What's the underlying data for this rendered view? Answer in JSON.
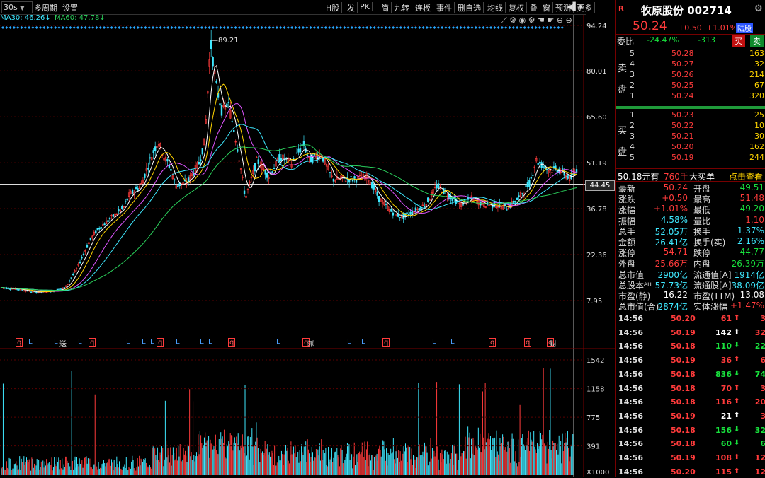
{
  "toolbar": {
    "period": "30s",
    "multi_period": "多周期",
    "settings": "设置",
    "right_items": [
      "H股",
      "发",
      "PK",
      "简",
      "九转",
      "连板",
      "事件",
      "删自选",
      "均线",
      "复权",
      "叠",
      "窗",
      "预测",
      "更多"
    ],
    "icons": [
      "back-arrow-icon",
      "dropdown-icon"
    ]
  },
  "ma_line": {
    "ma30_text": "MA30: 46.26↓",
    "ma60_text": "MA60: 47.78↓",
    "ma30_color": "#3ee8ff",
    "ma60_color": "#2bd15c"
  },
  "chart_tools": [
    "crosshair-icon",
    "gear-icon",
    "eye-icon",
    "gear2-icon",
    "hand-icon",
    "hand2-icon",
    "zoom-in-icon",
    "zoom-out-icon"
  ],
  "price_axis": {
    "labels": [
      "94.24",
      "80.01",
      "65.60",
      "51.19",
      "36.78",
      "22.36",
      "7.95"
    ],
    "current": "44.45"
  },
  "peak_label": "89.21",
  "event_markers": [
    "q",
    "L",
    "L",
    "L",
    "q",
    "L",
    "L",
    "L",
    "q",
    "L",
    "L",
    "L",
    "q",
    "L",
    "q",
    "L",
    "L",
    "q",
    "L",
    "L",
    "q",
    "q",
    "q"
  ],
  "event_extra": [
    "送",
    "派",
    "财"
  ],
  "volume_axis": {
    "labels": [
      "1542",
      "1158",
      "775",
      "391"
    ],
    "unit": "X1000"
  },
  "chart_data": {
    "type": "line",
    "title": "",
    "y_range": [
      0,
      94.24
    ],
    "reference_price": 44.45,
    "peak": 89.21,
    "price_path": [
      [
        0,
        12.0
      ],
      [
        3,
        11.5
      ],
      [
        6,
        10.5
      ],
      [
        9,
        11.0
      ],
      [
        11,
        12.0
      ],
      [
        13,
        18
      ],
      [
        15,
        26
      ],
      [
        16,
        29
      ],
      [
        17,
        31
      ],
      [
        19,
        34
      ],
      [
        21,
        37
      ],
      [
        22,
        41
      ],
      [
        24,
        44
      ],
      [
        26,
        54
      ],
      [
        27,
        58
      ],
      [
        28,
        53
      ],
      [
        29,
        50
      ],
      [
        30,
        44
      ],
      [
        32,
        45
      ],
      [
        34,
        51
      ],
      [
        35,
        58
      ],
      [
        36,
        89.2
      ],
      [
        37,
        75
      ],
      [
        38,
        67
      ],
      [
        39,
        70
      ],
      [
        40,
        62
      ],
      [
        41,
        52
      ],
      [
        42,
        40
      ],
      [
        43,
        46
      ],
      [
        44,
        52
      ],
      [
        46,
        47
      ],
      [
        48,
        53
      ],
      [
        50,
        51
      ],
      [
        52,
        57
      ],
      [
        53,
        52
      ],
      [
        55,
        54
      ],
      [
        57,
        46
      ],
      [
        59,
        46
      ],
      [
        61,
        46
      ],
      [
        63,
        47
      ],
      [
        65,
        40
      ],
      [
        67,
        36
      ],
      [
        69,
        34
      ],
      [
        71,
        36
      ],
      [
        73,
        38
      ],
      [
        75,
        44
      ],
      [
        77,
        41
      ],
      [
        79,
        38
      ],
      [
        81,
        40
      ],
      [
        83,
        38
      ],
      [
        85,
        38
      ],
      [
        87,
        37
      ],
      [
        89,
        40
      ],
      [
        91,
        45
      ],
      [
        92,
        52
      ],
      [
        94,
        49
      ],
      [
        96,
        49
      ],
      [
        98,
        46
      ],
      [
        99,
        49
      ]
    ],
    "volume_scale_max": 1542
  },
  "right_panel": {
    "logo": "R",
    "stock_name": "牧原股份",
    "code": "002714",
    "price": "50.24",
    "change": "+0.50",
    "change_pct": "+1.01%",
    "badge": "陆股",
    "weibi_label": "委比",
    "weibi_value": "-24.47%",
    "weicha_value": "-313",
    "buy_btn": "买",
    "sell_btn": "卖",
    "sell_side_label": [
      "卖",
      "盘"
    ],
    "buy_side_label": [
      "买",
      "盘"
    ],
    "asks": [
      {
        "level": "5",
        "price": "50.28",
        "vol": "163"
      },
      {
        "level": "4",
        "price": "50.27",
        "vol": "32"
      },
      {
        "level": "3",
        "price": "50.26",
        "vol": "214"
      },
      {
        "level": "2",
        "price": "50.25",
        "vol": "67"
      },
      {
        "level": "1",
        "price": "50.24",
        "vol": "320"
      }
    ],
    "bids": [
      {
        "level": "1",
        "price": "50.23",
        "vol": "25"
      },
      {
        "level": "2",
        "price": "50.22",
        "vol": "10"
      },
      {
        "level": "3",
        "price": "50.21",
        "vol": "30"
      },
      {
        "level": "4",
        "price": "50.20",
        "vol": "162"
      },
      {
        "level": "5",
        "price": "50.19",
        "vol": "244"
      }
    ],
    "big_order": {
      "price": "50.18元有",
      "qty": "760手",
      "type": "大买单",
      "link": "点击查看"
    },
    "stats": [
      {
        "l1": "最新",
        "v1": "50.24",
        "c1": "red",
        "l2": "开盘",
        "v2": "49.51",
        "c2": "green"
      },
      {
        "l1": "涨跌",
        "v1": "+0.50",
        "c1": "red",
        "l2": "最高",
        "v2": "51.48",
        "c2": "red"
      },
      {
        "l1": "涨幅",
        "v1": "+1.01%",
        "c1": "red",
        "l2": "最低",
        "v2": "49.20",
        "c2": "green"
      },
      {
        "l1": "振幅",
        "v1": "4.58%",
        "c1": "cyan",
        "l2": "量比",
        "v2": "1.10",
        "c2": "red"
      },
      {
        "l1": "总手",
        "v1": "52.05万",
        "c1": "cyan",
        "l2": "换手",
        "v2": "1.37%",
        "c2": "cyan"
      },
      {
        "l1": "金额",
        "v1": "26.41亿",
        "c1": "cyan",
        "l2": "换手(实)",
        "v2": "2.16%",
        "c2": "cyan"
      },
      {
        "l1": "涨停",
        "v1": "54.71",
        "c1": "red",
        "l2": "跌停",
        "v2": "44.77",
        "c2": "green"
      },
      {
        "l1": "外盘",
        "v1": "25.66万",
        "c1": "red",
        "l2": "内盘",
        "v2": "26.39万",
        "c2": "green"
      },
      {
        "l1": "总市值",
        "v1": "2900亿",
        "c1": "cyan",
        "l2": "流通值[A]",
        "v2": "1914亿",
        "c2": "cyan"
      },
      {
        "l1": "总股本ᴬᴴ",
        "v1": "57.73亿",
        "c1": "cyan",
        "l2": "流通股[A]",
        "v2": "38.09亿",
        "c2": "cyan"
      },
      {
        "l1": "市盈(静)",
        "v1": "16.22",
        "c1": "white",
        "l2": "市盈(TTM)",
        "v2": "13.08",
        "c2": "white"
      },
      {
        "l1": "总市值(合)",
        "v1": "2874亿",
        "c1": "cyan",
        "l2": "实体涨幅",
        "v2": "+1.47%",
        "c2": "red"
      }
    ],
    "ticks": [
      {
        "time": "14:56",
        "price": "50.20",
        "pc": "red",
        "vol": "61",
        "vc": "red",
        "dir": "up",
        "n": "3"
      },
      {
        "time": "14:56",
        "price": "50.19",
        "pc": "red",
        "vol": "142",
        "vc": "white",
        "dir": "up",
        "n": "32"
      },
      {
        "time": "14:56",
        "price": "50.18",
        "pc": "red",
        "vol": "110",
        "vc": "green",
        "dir": "down",
        "n": "22"
      },
      {
        "time": "14:56",
        "price": "50.19",
        "pc": "red",
        "vol": "36",
        "vc": "red",
        "dir": "up",
        "n": "6"
      },
      {
        "time": "14:56",
        "price": "50.18",
        "pc": "red",
        "vol": "836",
        "vc": "green",
        "dir": "down",
        "n": "74"
      },
      {
        "time": "14:56",
        "price": "50.18",
        "pc": "red",
        "vol": "70",
        "vc": "red",
        "dir": "up",
        "n": "3"
      },
      {
        "time": "14:56",
        "price": "50.18",
        "pc": "red",
        "vol": "116",
        "vc": "red",
        "dir": "up",
        "n": "20"
      },
      {
        "time": "14:56",
        "price": "50.19",
        "pc": "red",
        "vol": "21",
        "vc": "white",
        "dir": "up",
        "n": "3"
      },
      {
        "time": "14:56",
        "price": "50.18",
        "pc": "red",
        "vol": "156",
        "vc": "green",
        "dir": "down",
        "n": "32"
      },
      {
        "time": "14:56",
        "price": "50.18",
        "pc": "red",
        "vol": "60",
        "vc": "green",
        "dir": "down",
        "n": "6"
      },
      {
        "time": "14:56",
        "price": "50.19",
        "pc": "red",
        "vol": "108",
        "vc": "red",
        "dir": "up",
        "n": "12"
      },
      {
        "time": "14:56",
        "price": "50.20",
        "pc": "red",
        "vol": "115",
        "vc": "red",
        "dir": "up",
        "n": "12"
      }
    ]
  }
}
